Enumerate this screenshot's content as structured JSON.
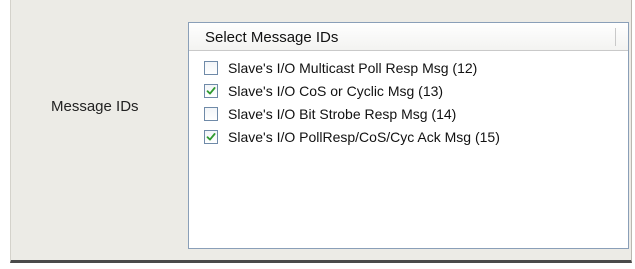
{
  "form": {
    "field_label": "Message IDs"
  },
  "listbox": {
    "header": "Select Message IDs",
    "items": [
      {
        "label": "Slave's I/O Multicast Poll Resp Msg (12)",
        "checked": false
      },
      {
        "label": "Slave's I/O CoS or Cyclic Msg (13)",
        "checked": true
      },
      {
        "label": "Slave's I/O Bit Strobe Resp Msg (14)",
        "checked": false
      },
      {
        "label": "Slave's I/O PollResp/CoS/Cyc Ack Msg (15)",
        "checked": true
      }
    ]
  },
  "colors": {
    "check_mark": "#2f9a2f"
  },
  "icons": {
    "check": "check-mark-icon"
  }
}
